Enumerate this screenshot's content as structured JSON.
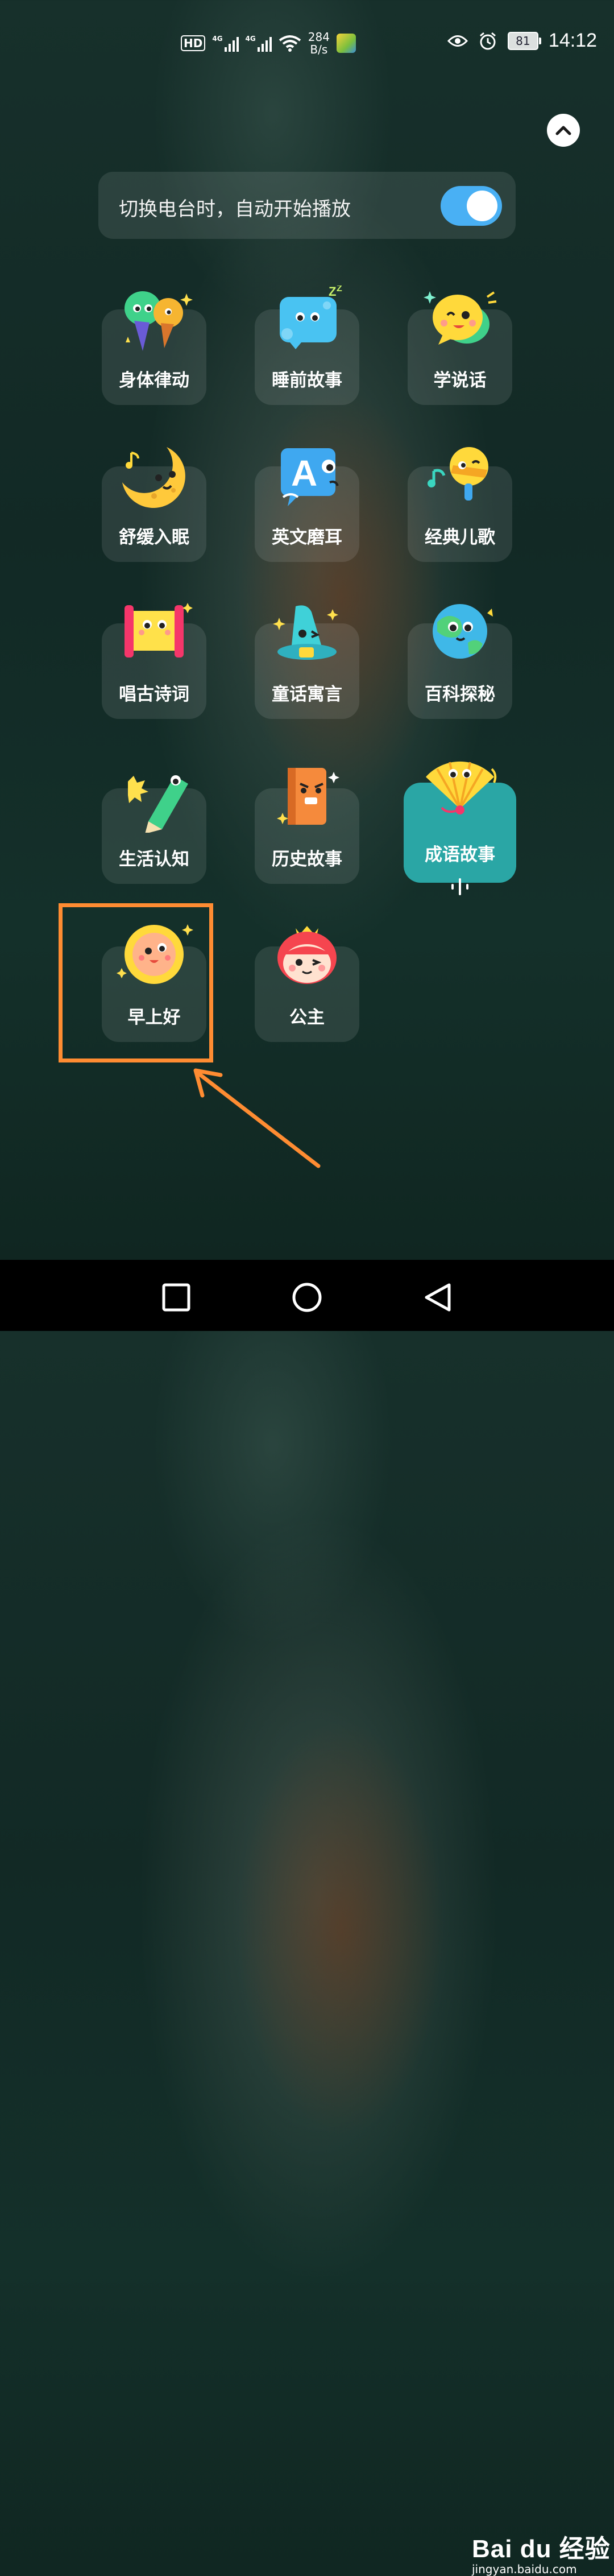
{
  "status_bar": {
    "hd_label": "HD",
    "network_type_1": "4G",
    "network_type_2": "4G",
    "net_speed_value": "284",
    "net_speed_unit": "B/s",
    "battery_level": "81",
    "time": "14:12"
  },
  "toggle": {
    "label": "切换电台时，自动开始播放",
    "enabled": true
  },
  "stations": [
    {
      "label": "身体律动",
      "icon": "microphones-icon"
    },
    {
      "label": "睡前故事",
      "icon": "sleepy-cloud-icon"
    },
    {
      "label": "学说话",
      "icon": "speech-bubble-icon"
    },
    {
      "label": "舒缓入眠",
      "icon": "moon-icon"
    },
    {
      "label": "英文磨耳",
      "icon": "english-letter-icon"
    },
    {
      "label": "经典儿歌",
      "icon": "singing-microphone-icon"
    },
    {
      "label": "唱古诗词",
      "icon": "scroll-icon"
    },
    {
      "label": "童话寓言",
      "icon": "wizard-hat-icon"
    },
    {
      "label": "百科探秘",
      "icon": "globe-icon"
    },
    {
      "label": "生活认知",
      "icon": "pencil-icon"
    },
    {
      "label": "历史故事",
      "icon": "book-icon"
    },
    {
      "label": "成语故事",
      "icon": "fan-icon",
      "playing": true
    },
    {
      "label": "早上好",
      "icon": "sun-icon",
      "highlighted": true
    },
    {
      "label": "公主",
      "icon": "princess-icon"
    }
  ],
  "watermark": {
    "brand": "Bai du 经验",
    "url": "jingyan.baidu.com"
  },
  "colors": {
    "accent_toggle": "#49b0f4",
    "active_tile": "#2aa6a5",
    "highlight": "#ff8c32"
  }
}
